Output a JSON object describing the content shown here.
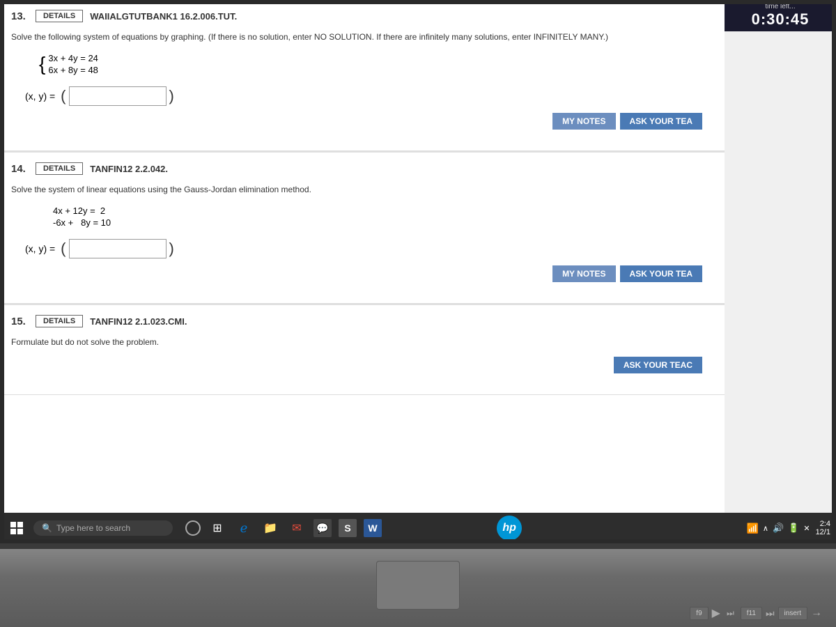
{
  "timer": {
    "label": "time left...",
    "value": "0:30:45"
  },
  "questions": [
    {
      "number": "13.",
      "details_label": "DETAILS",
      "title": "WAIIALGTUTBANK1 16.2.006.TUT.",
      "prompt": "Solve the following system of equations by graphing. (If there is no solution, enter NO SOLUTION. If there are infinitely many solutions, enter INFINITELY MANY.)",
      "equations": [
        "3x + 4y  =  24",
        "6x + 8y  =  48"
      ],
      "answer_label": "(x, y) =",
      "input_value": "",
      "my_notes": "MY NOTES",
      "ask_teacher": "ASK YOUR TEA"
    },
    {
      "number": "14.",
      "details_label": "DETAILS",
      "title": "TANFIN12 2.2.042.",
      "prompt": "Solve the system of linear equations using the Gauss-Jordan elimination method.",
      "equations": [
        "4x + 12y  =    2",
        "-6x +   8y  =  10"
      ],
      "answer_label": "(x, y) =",
      "input_value": "",
      "my_notes": "MY NOTES",
      "ask_teacher": "ASK YOUR TEA"
    },
    {
      "number": "15.",
      "details_label": "DETAILS",
      "title": "TANFIN12 2.1.023.CMI.",
      "prompt": "Formulate but do not solve the problem.",
      "my_notes": "",
      "ask_teacher": "ASK YOUR TEAC"
    }
  ],
  "taskbar": {
    "search_placeholder": "Type here to search",
    "icons": [
      "⊞",
      "⬜",
      "🌐",
      "📁",
      "✉",
      "💬",
      "S",
      "W"
    ],
    "clock": {
      "time": "2:4",
      "date": "12/1"
    }
  }
}
